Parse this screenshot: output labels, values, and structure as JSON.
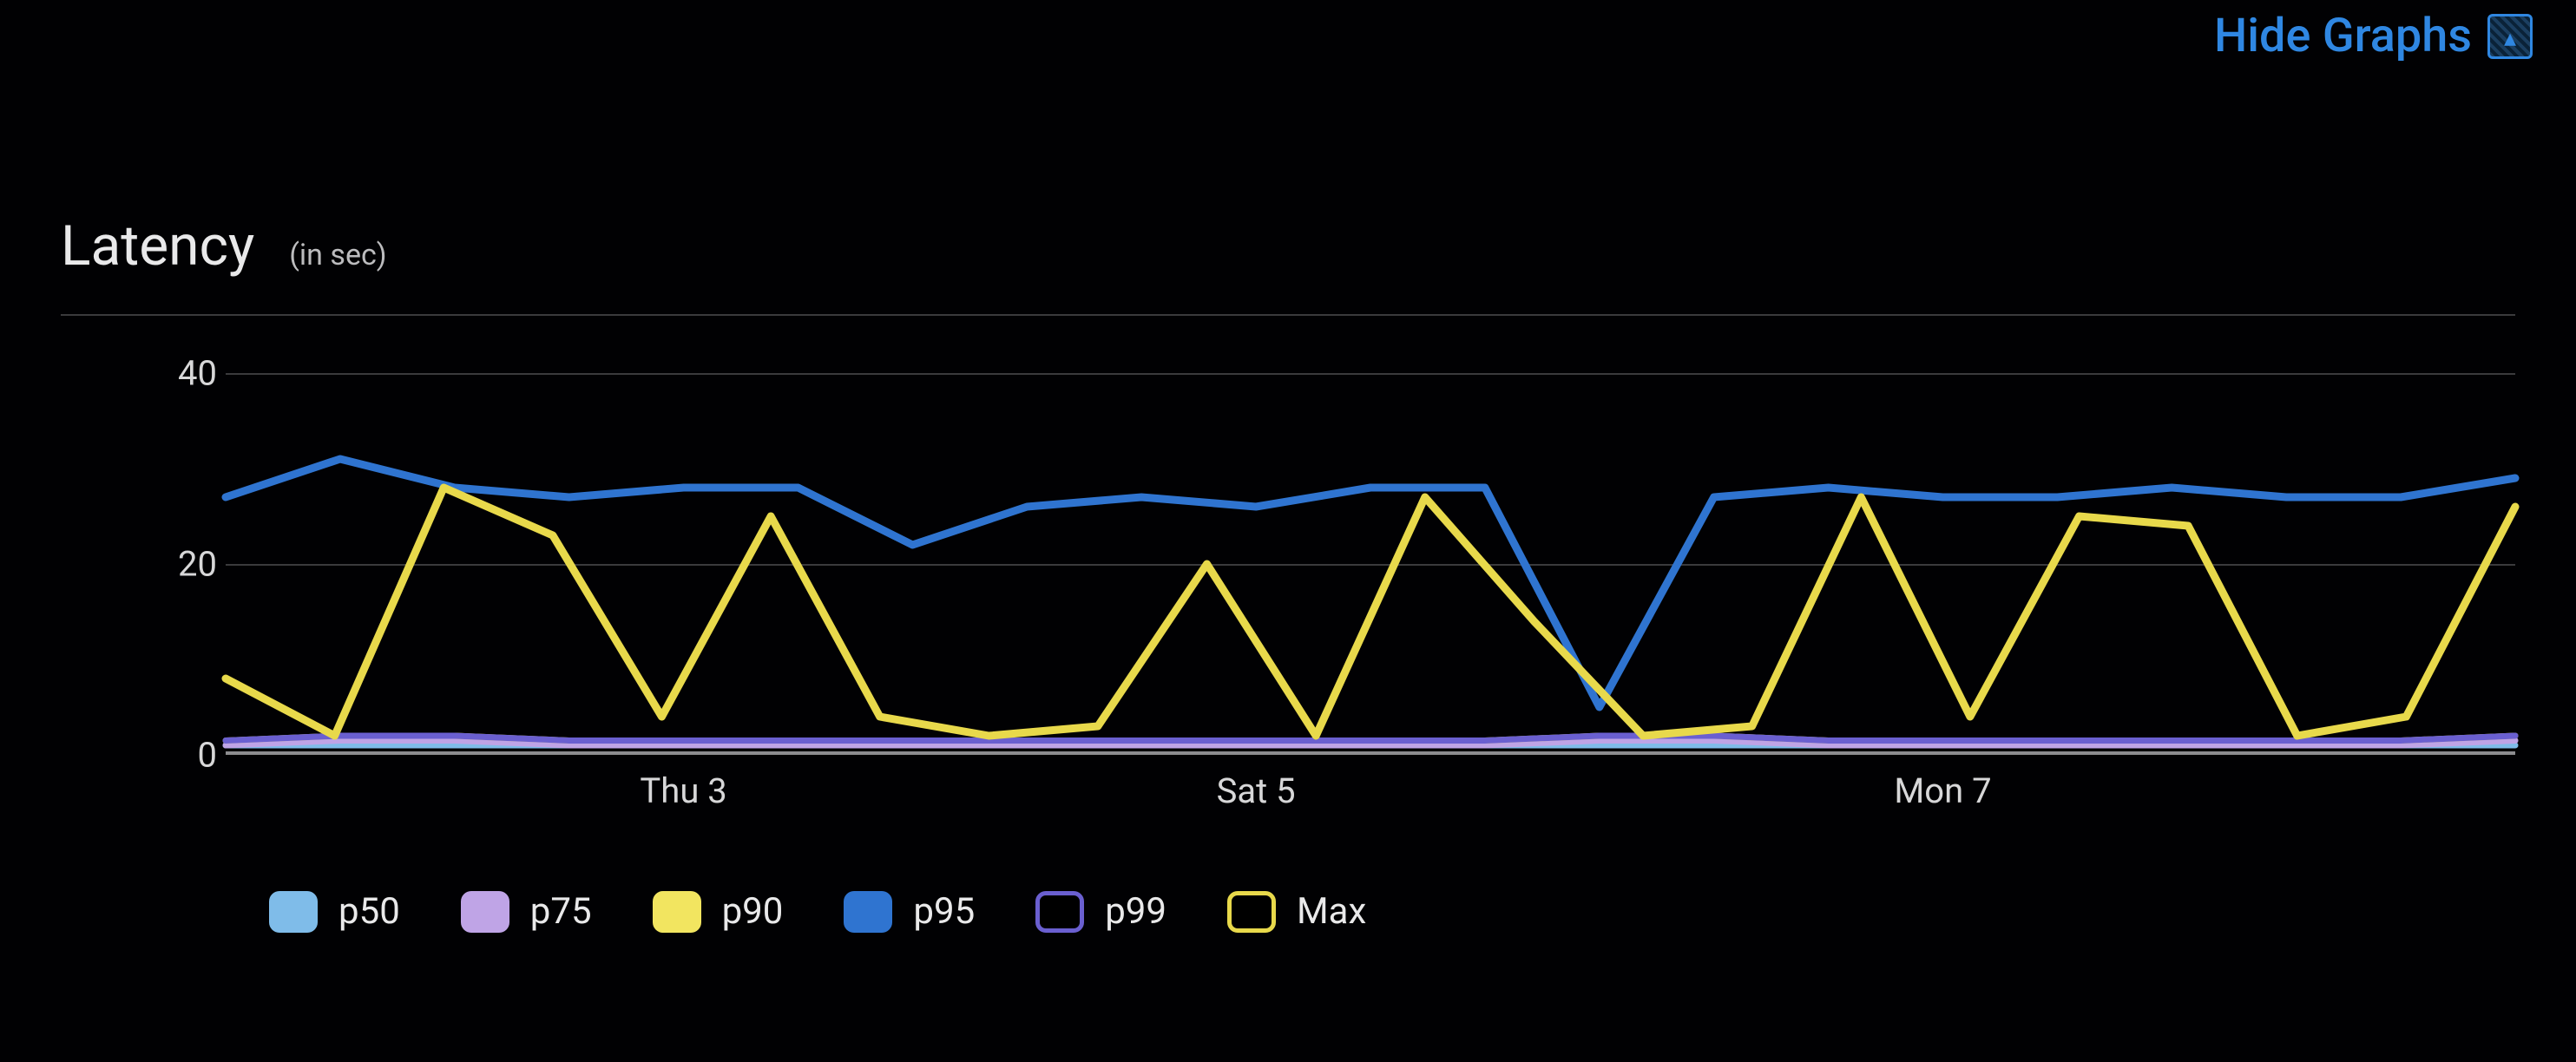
{
  "toggle": {
    "label": "Hide Graphs"
  },
  "header": {
    "title": "Latency",
    "unit": "(in sec)"
  },
  "chart_data": {
    "type": "line",
    "title": "Latency (in sec)",
    "xlabel": "",
    "ylabel": "",
    "ylim": [
      0,
      40
    ],
    "y_ticks": [
      0,
      20,
      40
    ],
    "x": [
      0,
      1,
      2,
      3,
      4,
      5,
      6,
      7,
      8,
      9,
      10,
      11,
      12,
      13,
      14,
      15,
      16,
      17,
      18,
      19,
      20
    ],
    "x_tick_labels": {
      "4": "Thu 3",
      "9": "Sat 5",
      "15": "Mon 7"
    },
    "series": [
      {
        "name": "p50",
        "color": "#7fbce9",
        "hollow": false,
        "values": [
          1,
          1,
          1,
          1,
          1,
          1,
          1,
          1,
          1,
          1,
          1,
          1,
          1,
          1,
          1,
          1,
          1,
          1,
          1,
          1,
          1
        ]
      },
      {
        "name": "p75",
        "color": "#bfa4e6",
        "hollow": false,
        "values": [
          1,
          1.5,
          1.5,
          1,
          1,
          1,
          1,
          1,
          1,
          1,
          1,
          1,
          1.5,
          1.5,
          1,
          1,
          1,
          1,
          1,
          1,
          1.5
        ]
      },
      {
        "name": "p90",
        "color": "#f2e560",
        "hollow": false,
        "values": [
          1.5,
          2,
          2,
          1.5,
          1.5,
          1.5,
          1.5,
          1.5,
          1.5,
          1.5,
          1.5,
          1.5,
          2,
          2,
          1.5,
          1.5,
          1.5,
          1.5,
          1.5,
          1.5,
          2
        ]
      },
      {
        "name": "p95",
        "color": "#2f74d0",
        "hollow": false,
        "values": [
          27,
          31,
          28,
          27,
          28,
          28,
          22,
          26,
          27,
          26,
          28,
          28,
          5,
          27,
          28,
          27,
          27,
          28,
          27,
          27,
          29
        ]
      },
      {
        "name": "p99",
        "color": "#6a5fd0",
        "hollow": true,
        "values": [
          1.5,
          2,
          2,
          1.5,
          1.5,
          1.5,
          1.5,
          1.5,
          1.5,
          1.5,
          1.5,
          1.5,
          2,
          2,
          1.5,
          1.5,
          1.5,
          1.5,
          1.5,
          1.5,
          2
        ]
      },
      {
        "name": "Max",
        "color": "#e8d94b",
        "hollow": true,
        "values": [
          8,
          2,
          28,
          23,
          4,
          25,
          4,
          2,
          3,
          20,
          2,
          27,
          14,
          2,
          3,
          27,
          4,
          25,
          24,
          2,
          4,
          26
        ]
      }
    ]
  },
  "yaxis": {
    "t0": "0",
    "t20": "20",
    "t40": "40"
  },
  "xaxis": {
    "thu": "Thu 3",
    "sat": "Sat 5",
    "mon": "Mon 7"
  },
  "legend": {
    "p50": "p50",
    "p75": "p75",
    "p90": "p90",
    "p95": "p95",
    "p99": "p99",
    "max": "Max"
  }
}
